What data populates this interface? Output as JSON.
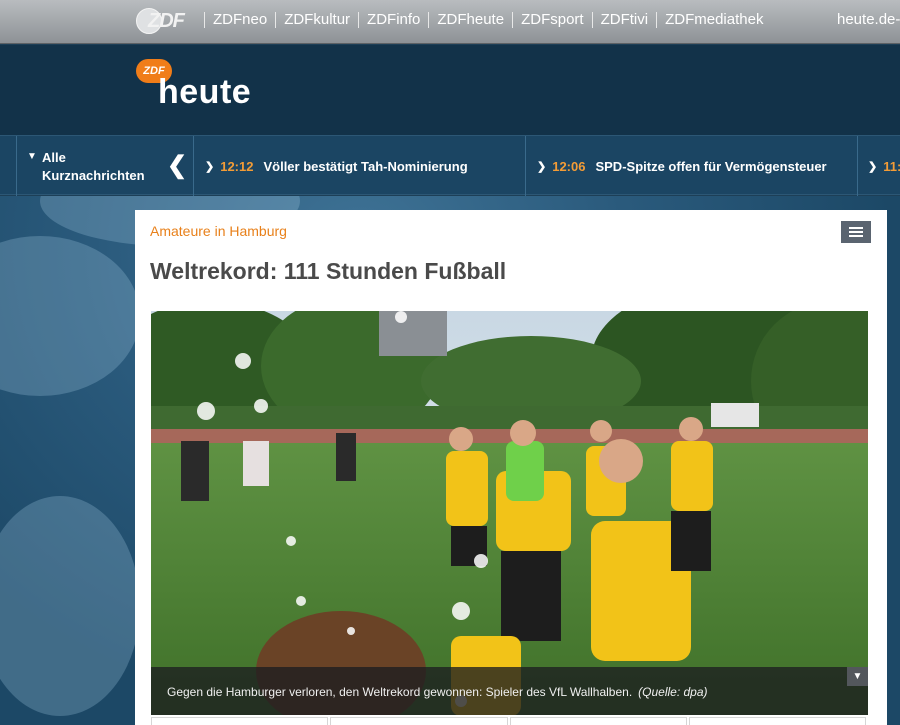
{
  "network": {
    "logo_text": "ZDF",
    "links": [
      "ZDFneo",
      "ZDFkultur",
      "ZDFinfo",
      "ZDFheute",
      "ZDFsport",
      "ZDFtivi",
      "ZDFmediathek"
    ],
    "right_link": "heute.de-"
  },
  "header": {
    "logo_badge": "ZDF",
    "logo_word": "heute"
  },
  "ticker": {
    "all_line1": "Alle",
    "all_line2": "Kurznachrichten",
    "items": [
      {
        "time": "12:12",
        "text": "Völler bestätigt Tah-Nominierung"
      },
      {
        "time": "12:06",
        "text": "SPD-Spitze offen für Vermögensteuer"
      },
      {
        "time": "11:",
        "text": ""
      }
    ]
  },
  "article": {
    "kicker": "Amateure in Hamburg",
    "headline": "Weltrekord: 111 Stunden Fußball",
    "caption": "Gegen die Hamburger verloren, den Weltrekord gewonnen: Spieler des VfL Wallhalben.",
    "source": "(Quelle: dpa)"
  },
  "icons": {
    "toc": "list-icon",
    "caption_toggle": "chevron-down-icon",
    "ticker_back": "chevron-left-icon"
  },
  "colors": {
    "accent_orange": "#e8801a",
    "header_navy": "#123249",
    "ticker_blue": "#1b4563"
  }
}
